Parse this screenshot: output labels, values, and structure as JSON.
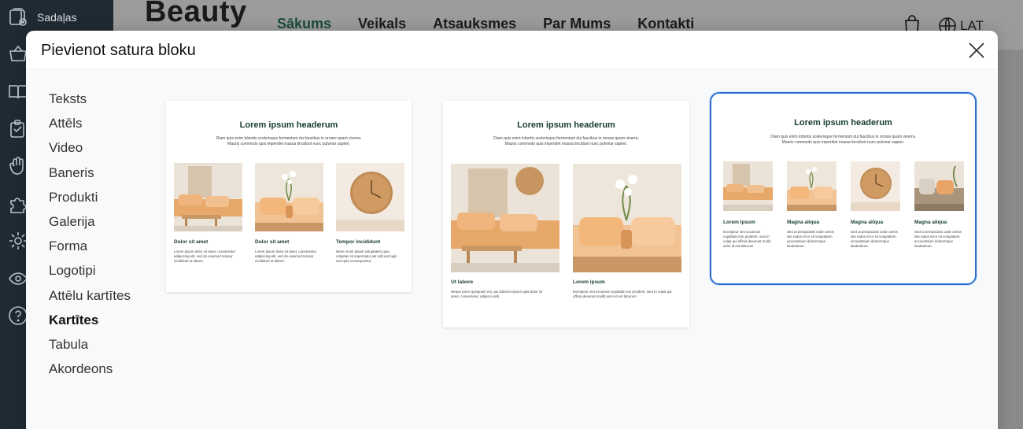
{
  "sidebar": {
    "label": "Sadaļas",
    "icons": [
      "sections-icon",
      "basket-icon",
      "book-icon",
      "clipboard-icon",
      "hand-icon",
      "puzzle-icon",
      "gear-icon",
      "eye-icon",
      "help-icon"
    ]
  },
  "site": {
    "brand": "Beauty",
    "nav": [
      "Sākums",
      "Veikals",
      "Atsauksmes",
      "Par Mums",
      "Kontakti"
    ],
    "active_nav": "Sākums",
    "lang": "LAT"
  },
  "modal": {
    "title": "Pievienot satura bloku",
    "menu": [
      "Teksts",
      "Attēls",
      "Video",
      "Baneris",
      "Produkti",
      "Galerija",
      "Forma",
      "Logotipi",
      "Attēlu kartītes",
      "Kartītes",
      "Tabula",
      "Akordeons"
    ],
    "active_menu": "Kartītes"
  },
  "templates": [
    {
      "title": "Lorem ipsum headerum",
      "desc": [
        "Diam quis enim lobortis scelerisque fermentum dui faucibus in ornare quam viverra.",
        "Mauris commodo quis imperdiet massa tincidunt nunc pulvinar sapien."
      ],
      "cards": [
        {
          "caption": "Dolor sit amet",
          "text": "Lorem ipsum dolor sit amet, consectetur adipiscing elit, sed do eiusmod tempor incididunt ut labore."
        },
        {
          "caption": "Dolor sit amet",
          "text": "Lorem ipsum dolor sit amet, consectetur adipiscing elit, sed do eiusmod tempor incididunt ut labore."
        },
        {
          "caption": "Tempor incididunt",
          "text": "Nemo enim ipsam voluptatem quia voluptas sit aspernatur aut odit aut fugit, sed quia consequuntur."
        }
      ]
    },
    {
      "title": "Lorem ipsum headerum",
      "desc": [
        "Diam quis enim lobortis scelerisque fermentum dui faucibus in ornare quam viverra.",
        "Mauris commodo quis imperdiet massa tincidunt nunc pulvinar sapien."
      ],
      "cards": [
        {
          "caption": "Ut labore",
          "text": "Neque porro quisquam est, qui dolorem ipsum quia dolor sit amet, consectetur, adipisci velit."
        },
        {
          "caption": "Lorem ipsum",
          "text": "Excepteur sint occaecat cupidatat non proident, sunt in culpa qui officia deserunt mollit anim id est laborum."
        }
      ]
    },
    {
      "title": "Lorem ipsum headerum",
      "desc": [
        "Diam quis enim lobortis scelerisque fermentum dui faucibus in ornare quam viverra.",
        "Mauris commodo quis imperdiet massa tincidunt nunc pulvinar sapien."
      ],
      "cards": [
        {
          "caption": "Lorem ipsum",
          "text": "Excepteur sint occaecat cupidatat non proident, sunt in culpa qui officia deserunt mollit anim id est laborum."
        },
        {
          "caption": "Magna aliqua",
          "text": "Sed ut perspiciatis unde omnis iste natus error sit voluptatem accusantium doloremque laudantium."
        },
        {
          "caption": "Magna aliqua",
          "text": "Sed ut perspiciatis unde omnis iste natus error sit voluptatem accusantium doloremque laudantium."
        },
        {
          "caption": "Magna aliqua",
          "text": "Sed ut perspiciatis unde omnis iste natus error sit voluptatem accusantium doloremque laudantium."
        }
      ]
    }
  ],
  "colors": {
    "accent": "#2c6fd1",
    "sidebar": "#1f2a33",
    "heading": "#163d2c"
  }
}
